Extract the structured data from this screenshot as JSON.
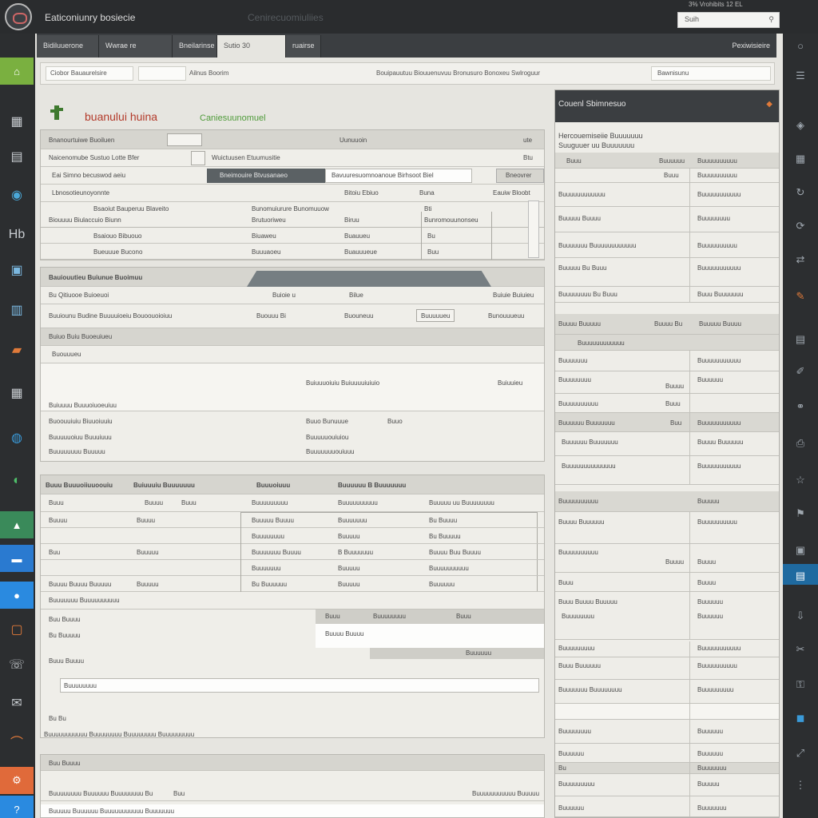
{
  "app": {
    "title": "Eaticoniunry bosiecie",
    "center_title": "Cenirecuomiuliies",
    "top_info": "3% Vrohibits  12  EL",
    "search_placeholder": "Suih"
  },
  "tabs": [
    {
      "label": "Bidiluuerone"
    },
    {
      "label": "Wwrae   re"
    },
    {
      "label": "Bneilarinse"
    },
    {
      "label": "Sutio  30"
    },
    {
      "label": "ruairse"
    }
  ],
  "tab_right": "Pexiwisieire",
  "toolbar": {
    "item1": "Ciobor  Bauaurelsire",
    "item2": "Ailnus  Boorim",
    "item3": "Bouipauutuu  Biouuenuvuu  Bronusuro  Bonoxeu  Swlroguur",
    "item4": "Bawnisunu"
  },
  "brand": {
    "title": "buanului  huina",
    "subtitle": "Caniesuunomuel"
  },
  "form1": {
    "header_left": "Bnanourtuiwe  Buoiluen",
    "header_mid": "Uunuuoin",
    "header_right": "ute",
    "row1_left": "Naicenomube  Sustuo Lotte  Bfer",
    "row1_mid": "Wuictuusen  Etuumusitie",
    "row1_right": "Btu",
    "row2_left": "Eai  Simno  becuswod aeiu",
    "row2_tab1": "Bneimouire  Btvusanaeo",
    "row2_tab2": "Bavuuresuomnoanoue  Birhsoot  Biel",
    "row2_btn": "Bneovrer",
    "sub_header": "Lbnosotieunoyonnte",
    "sub_cols": [
      "Bitoiu  Ebiuo",
      "Buna",
      "Eauiw  Bloobt"
    ],
    "t_head": [
      "Bsaoiut  Bauperuu  Blaveito",
      "Bunomuiurure  Bunomuuow",
      "Bti"
    ],
    "t_row0": [
      "Biouuuu  Biulaccuio  Biunn",
      "Brutuoriweu",
      "Biruu",
      "Bunromouunonseu"
    ],
    "t_row1": [
      "Bsaiouo  Bibuouo",
      "Biuaweu",
      "Buauueu",
      "Bu"
    ],
    "t_row2": [
      "Bueuuue  Bucono",
      "Buuuaoeu",
      "Buauuueue",
      "Buu"
    ]
  },
  "form2": {
    "header": "Bauiouutieu  Buiunue  Buoimuu",
    "row1": [
      "Bu  Qitiuooe  Buioeuoi",
      "Buioie  u",
      "Bilue",
      "Buiuie  Buiuieu"
    ],
    "row2": [
      "Buuiounu  Budine  Buuuuioeiu  Bouoouoioiuu",
      "Buouuu  Bi",
      "Buouneuu",
      "Buuuuueu",
      "Bunouuueuu"
    ],
    "section": "Buiuo  Buiu  Buoeuiueu",
    "sub": "Buouuueu",
    "line1": "Buiuuuoiuiu  Buiuuuuiuiuio",
    "line1r": "Buiuuieu",
    "ln_a": "Buiuuuu  Buuuoiuoeuiuu",
    "ln_b": [
      "Buoouuiuiu  Biuuoiuuiu",
      "Buuo  Bunuuue",
      "Buuo"
    ],
    "ln_c": [
      "Buuuuuoiuu  Buuuiuuu",
      "Buuuuuouiuiou"
    ],
    "ln_d": [
      "Buuuuuuuu  Buuuuu",
      "Buuuuuuuouiuuu"
    ]
  },
  "form3": {
    "header": [
      "Buuu  Buuuoiiuuoouiu",
      "Buiuuuiu  Buuuuuuu",
      "Buuuoiuuu",
      "Buuuuuu  B  Buuuuuuu"
    ],
    "cols": [
      "Buuu",
      "Buuuu",
      "Buuu",
      "Buuuuuuuuu",
      "Buuuuuuuuuu",
      "Buuuuu  uu  Buuuuuuuu"
    ],
    "rows": [
      [
        "Buuuu",
        "Buuuu",
        "Buuuuu  Buuuu",
        "Buuuuuuu",
        "Bu  Buuuu"
      ],
      [
        "",
        "",
        "Buuuuuuuu",
        "Buuuuu",
        "Bu  Buuuuu"
      ],
      [
        "Buu",
        "Buuuuu",
        "Buuuuuuu  Buuuu",
        "B  Buuuuuuu",
        "Buuuu  Buu  Buuuu"
      ],
      [
        "",
        "",
        "Buuuuuuu",
        "Buuuuu",
        "Buuuuuuuuuu"
      ],
      [
        "Buuuu  Buuuu  Buuuuu",
        "Buuuuu",
        "Bu  Buuuuuu",
        "Buuuuu",
        "Buuuuuu"
      ]
    ],
    "footer": "Buuuuuuu  Buuuuuuuuuu",
    "sub_cols": [
      "Buuu",
      "Buuuuuuuu",
      "Buuu"
    ],
    "sub_row1": "Buu  Buuuu",
    "sub_row2": [
      "Bu  Buuuuu",
      "Buuuu  Buuuu"
    ],
    "sub_row3": "Buuuuuu",
    "input_label": "Buuu  Buuuu",
    "input_value": "Buuuuuuuu",
    "small1": "Bu  Bu",
    "small2": "Buuuuuuuuuuu  Buuuuuuuu  Buuuuuuuu  Buuuuuuuuu"
  },
  "form4": {
    "header": "Buu  Buuuu",
    "row1": [
      "Buuuuuuuu  Buuuuuu  Buuuuuuuu  Bu",
      "Buu",
      "Buuuuuuuuuuu  Buuuuu"
    ],
    "row2": "Buuuuu  Buuuuuu  Buuuuuuuuuuu  Buuuuuuu"
  },
  "summary": {
    "title": "Couenl  Sbimnesuo",
    "intro1": "Hercouemiseiie  Buuuuuuu",
    "intro2": "Suuguuer  uu  Buuuuuuu",
    "cols": [
      "Buuu",
      "Buuuuuu",
      "Buuuuuuuuuu"
    ],
    "rows1": [
      [
        "Buuu",
        "Buuuuuuuuuu"
      ],
      [
        "Buuuuuuuuuuuu",
        "Buuuuuuuuuuu"
      ],
      [
        "Buuuuu  Buuuu",
        "Buuuuuuuu"
      ],
      [
        "Buuuuuuu  Buuuuuuuuuuuu",
        "Buuuuuuuuuu"
      ],
      [
        "Buuuuu  Bu  Buuu",
        "Buuuuuuuuuuu"
      ],
      [
        "Buuuuuuuu  Bu  Buuu",
        "Buuu  Buuuuuuu"
      ]
    ],
    "group1": [
      "Buuuu  Buuuuu",
      "Buuuu  Bu",
      "Buuuuu  Buuuu"
    ],
    "group1_sub": "Buuuuuuuuuuuu",
    "rows2": [
      [
        "Buuuuuuu",
        "Buuuuuuuuuuu"
      ],
      [
        "Buuuuuuuu",
        "Buuuu",
        "Buuuuuu"
      ],
      [
        "Buuuuuuuuuu",
        "Buuu"
      ],
      [
        "Buuuuuu  Buuuuuuu",
        "Buu",
        "Buuuuuuuuuuu"
      ],
      [
        "Buuuuuu  Buuuuuuu",
        "Buuuu  Buuuuuu"
      ],
      [
        "Buuuuuuuuuuuuuu",
        "Buuuuuuuuuuu"
      ]
    ],
    "group2": [
      "Buuuuuuuuuu",
      "Buuuuu"
    ],
    "rows3": [
      [
        "Buuuu  Buuuuuu",
        "Buuuuuuuuuu"
      ],
      [
        "Buuuuuuuuuu",
        "Buuuu",
        "Buuuu"
      ],
      [
        "Buuu",
        "Buuuu"
      ],
      [
        "Buuu  Buuuu  Buuuuu",
        "Buuuuuu"
      ],
      [
        "Buuuuuuuu",
        "Buuuuuu"
      ]
    ],
    "rows4": [
      [
        "Buuuuuuuuu",
        "Buuuuuuuuuuu"
      ],
      [
        "Buuu  Buuuuuu",
        "Buuuuuuuuuu"
      ],
      [
        "Buuuuuuu  Buuuuuuuu",
        "Buuuuuuuuu"
      ],
      [
        "Buuuuuuuu",
        "Buuuuuu"
      ],
      [
        "Buuuuuu",
        "Buuuuuu"
      ],
      [
        "Buuuuuuu",
        "Buuuuuu"
      ],
      [
        "Bu",
        "Buuuuuuu"
      ],
      [
        "Buuuuuuuuu",
        "Buuuuu"
      ],
      [
        "Buuuuuu",
        "Buuuuuuu"
      ]
    ]
  },
  "colors": {
    "accent_green": "#4f9b3a",
    "accent_red": "#b33a2a",
    "dark": "#3b3e41"
  }
}
